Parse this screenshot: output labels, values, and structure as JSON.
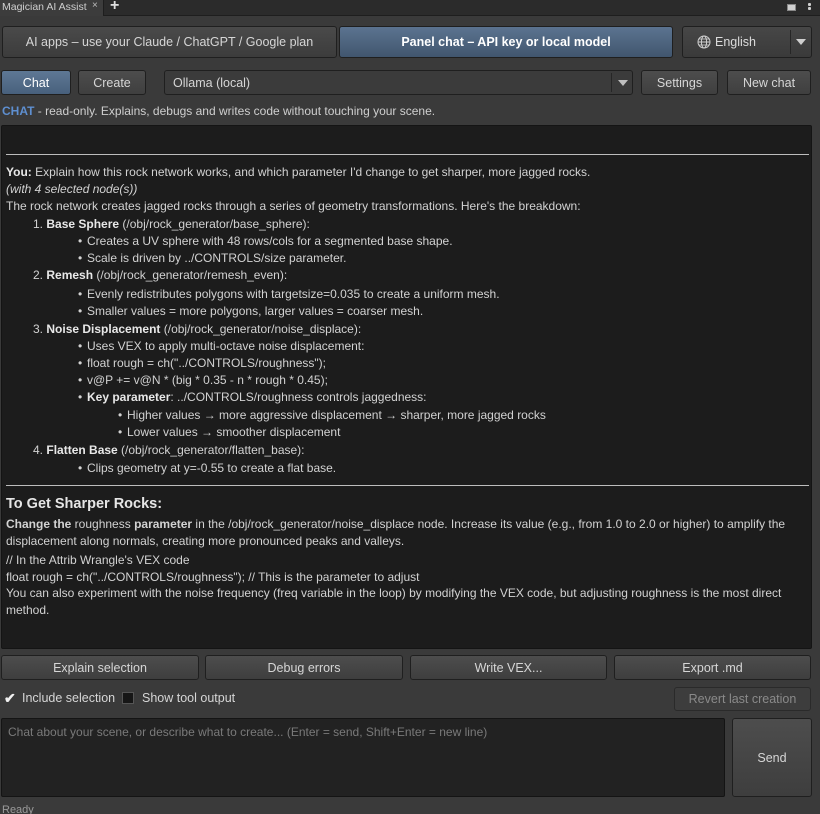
{
  "window": {
    "tab_title": "Magician AI Assist",
    "tab_close": "×",
    "tab_add": "+"
  },
  "modes": {
    "apps": "AI apps  –  use your Claude / ChatGPT / Google plan",
    "panel": "Panel chat  –  API key or local model"
  },
  "language": {
    "selected": "English"
  },
  "toolbar": {
    "chat": "Chat",
    "create": "Create",
    "model": "Ollama (local)",
    "settings": "Settings",
    "new_chat": "New chat"
  },
  "hint": {
    "keyword": "CHAT",
    "text": " - read-only. Explains, debugs and writes code without touching your scene."
  },
  "transcript": {
    "user_label": "You:",
    "user_text": " Explain how this rock network works, and which parameter I'd change to get sharper, more jagged rocks.",
    "selection_note": "(with 4 selected node(s))",
    "intro": "The rock network creates jagged rocks through a series of geometry transformations. Here's the breakdown:",
    "s1_num": "1.",
    "s1_title": "Base Sphere",
    "s1_path": " (/obj/rock_generator/base_sphere",
    "s1_tail": "):",
    "s1_b1": "Creates a UV sphere with 48 rows/cols for a segmented base shape.",
    "s1_b2": "Scale is driven by ../CONTROLS/size parameter.",
    "s2_num": "2.",
    "s2_title": "Remesh",
    "s2_path": " (/obj/rock_generator/remesh_even",
    "s2_tail": "):",
    "s2_b1": "Evenly redistributes polygons with targetsize=0.035 to create a uniform mesh.",
    "s2_b2": "Smaller values = more polygons, larger values = coarser mesh.",
    "s3_num": "3.",
    "s3_title": "Noise Displacement",
    "s3_path": " (/obj/rock_generator/noise_displace",
    "s3_tail": "):",
    "s3_b1": "Uses VEX to apply multi-octave noise displacement:",
    "s3_b2": "float rough = ch(\"../CONTROLS/roughness\");",
    "s3_b3": "v@P += v@N * (big * 0.35 - n * rough * 0.45);",
    "s3_b4_key": "Key parameter",
    "s3_b4_text": ": ../CONTROLS/roughness controls jaggedness:",
    "s3_sub1": "Higher values → more aggressive displacement → sharper, more jagged rocks",
    "s3_sub2": "Lower values → smoother displacement",
    "s4_num": "4.",
    "s4_title": "Flatten Base",
    "s4_path": " (/obj/rock_generator/flatten_base",
    "s4_tail": "):",
    "s4_b1": "Clips geometry at y=-0.55 to create a flat base.",
    "heading": "To Get Sharper Rocks:",
    "change_bold1": "Change the",
    "change_param": " roughness ",
    "change_bold2": "parameter",
    "change_text": " in the /obj/rock_generator/noise_displace node. Increase its value (e.g., from 1.0 to 2.0 or higher) to amplify the displacement along normals, creating more pronounced peaks and valleys.",
    "code1": "// In the Attrib Wrangle's VEX code",
    "code2": "float rough = ch(\"../CONTROLS/roughness\"); // This is the parameter to adjust",
    "closing": "You can also experiment with the noise frequency (freq variable in the loop) by modifying the VEX code, but adjusting roughness is the most direct method."
  },
  "actions": {
    "explain": "Explain selection",
    "debug": "Debug errors",
    "vex": "Write VEX...",
    "export": "Export .md"
  },
  "options": {
    "include_selection": "Include selection",
    "include_checked_mark": "✔",
    "show_tool_output": "Show tool output",
    "revert": "Revert last creation"
  },
  "composer": {
    "placeholder": "Chat about your scene, or describe what to create...  (Enter = send, Shift+Enter = new line)",
    "send": "Send"
  },
  "status": "Ready"
}
